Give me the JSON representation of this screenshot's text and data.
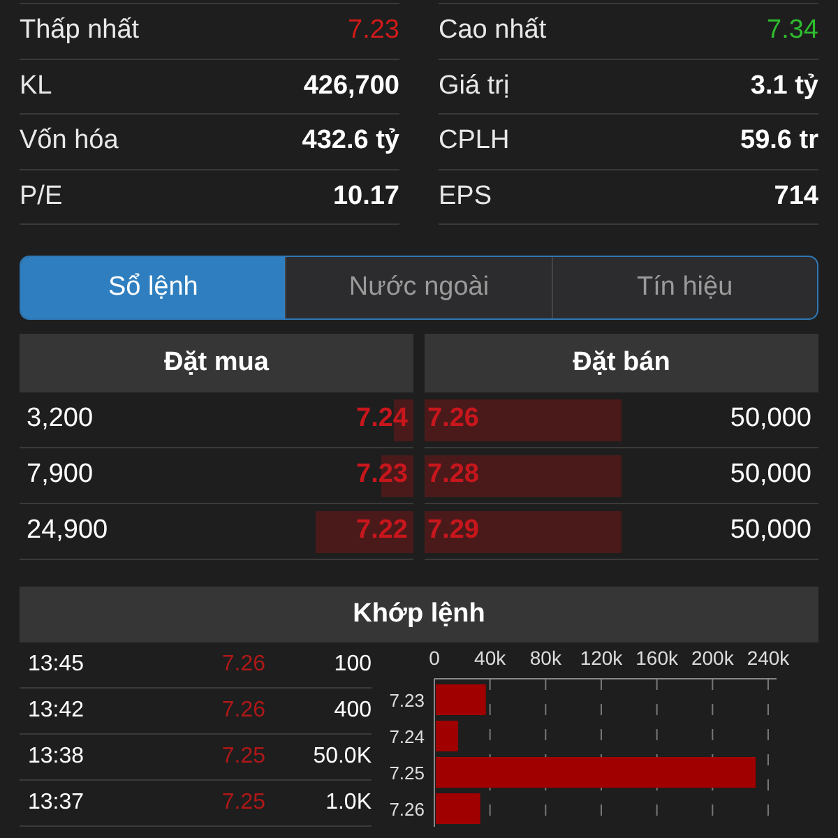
{
  "stats": [
    {
      "left": {
        "label": "Thấp nhất",
        "value": "7.23",
        "kind": "price",
        "color": "#d11a1a"
      },
      "right": {
        "label": "Cao nhất",
        "value": "7.34",
        "kind": "price",
        "color": "#2ebd2e"
      }
    },
    {
      "left": {
        "label": "KL",
        "value": "426,700",
        "kind": "figure"
      },
      "right": {
        "label": "Giá trị",
        "value": "3.1 tỷ",
        "kind": "figure"
      }
    },
    {
      "left": {
        "label": "Vốn hóa",
        "value": "432.6 tỷ",
        "kind": "figure"
      },
      "right": {
        "label": "CPLH",
        "value": "59.6 tr",
        "kind": "figure"
      }
    },
    {
      "left": {
        "label": "P/E",
        "value": "10.17",
        "kind": "figure"
      },
      "right": {
        "label": "EPS",
        "value": "714",
        "kind": "figure"
      }
    }
  ],
  "tabs": [
    {
      "label": "Sổ lệnh",
      "selected": true
    },
    {
      "label": "Nước ngoài",
      "selected": false
    },
    {
      "label": "Tín hiệu",
      "selected": false
    }
  ],
  "order_book": {
    "buy_title": "Đặt mua",
    "sell_title": "Đặt bán",
    "rows": [
      {
        "buy": {
          "volume": "3,200",
          "price": "7.24",
          "level": 0.05
        },
        "sell": {
          "price": "7.26",
          "level": 0.5,
          "volume": "50,000"
        }
      },
      {
        "buy": {
          "volume": "7,900",
          "price": "7.23",
          "level": 0.08
        },
        "sell": {
          "price": "7.28",
          "level": 0.5,
          "volume": "50,000"
        }
      },
      {
        "buy": {
          "volume": "24,900",
          "price": "7.22",
          "level": 0.25
        },
        "sell": {
          "price": "7.29",
          "level": 0.5,
          "volume": "50,000"
        }
      }
    ]
  },
  "matched": {
    "title": "Khớp lệnh",
    "trades": [
      {
        "time": "13:45",
        "price": "7.26",
        "volume": "100"
      },
      {
        "time": "13:42",
        "price": "7.26",
        "volume": "400"
      },
      {
        "time": "13:38",
        "price": "7.25",
        "volume": "50.0K"
      },
      {
        "time": "13:37",
        "price": "7.25",
        "volume": "1.0K"
      }
    ],
    "chart_data": {
      "type": "bar",
      "orientation": "horizontal",
      "categories": [
        "7.23",
        "7.24",
        "7.25",
        "7.26"
      ],
      "series": [
        {
          "color": "#a00000",
          "values": [
            36000,
            16000,
            230000,
            32000
          ]
        }
      ],
      "grid": true,
      "xlim": [
        0,
        240000
      ],
      "xticks": [
        {
          "value": 0,
          "label": "0"
        },
        {
          "value": 40000,
          "label": "40k"
        },
        {
          "value": 80000,
          "label": "80k"
        },
        {
          "value": 120000,
          "label": "120k"
        },
        {
          "value": 160000,
          "label": "160k"
        },
        {
          "value": 200000,
          "label": "200k"
        },
        {
          "value": 240000,
          "label": "240k"
        }
      ]
    }
  }
}
